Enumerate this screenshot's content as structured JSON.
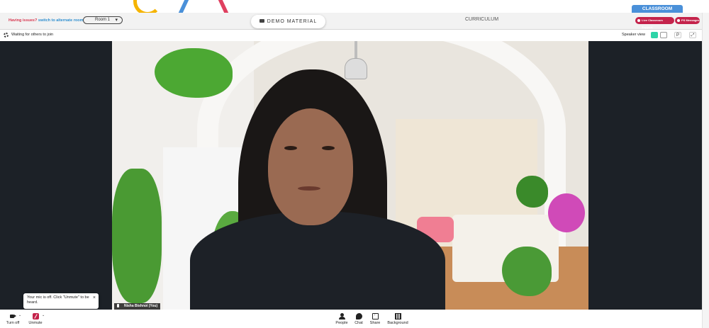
{
  "header": {
    "issue_prefix": "Having issues?",
    "issue_link": "switch to alternate room",
    "room_value": "Room 1",
    "demo_material_label": "DEMO MATERIAL",
    "curriculum_label": "CURRICULUM",
    "classroom_tab": "CLASSROOM",
    "pill_support": "Live Classroom Support",
    "pill_messages": "PS Messages"
  },
  "meeting": {
    "waiting_text": "Waiting for others to join",
    "speaker_view_label": "Speaker view",
    "p_button": "P",
    "fullscreen_button": "⤢"
  },
  "video": {
    "participant_name": "Nisha Bishnoi (You)"
  },
  "toast": {
    "message": "Your mic is off. Click \"Unmute\" to be heard.",
    "close": "×"
  },
  "toolbar": {
    "camera_label": "Turn off",
    "mic_label": "Unmute",
    "people_label": "People",
    "chat_label": "Chat",
    "share_label": "Share",
    "background_label": "Background"
  },
  "colors": {
    "accent_red": "#c4234b",
    "accent_blue": "#4a90d9",
    "active_view": "#2dd4a7"
  }
}
